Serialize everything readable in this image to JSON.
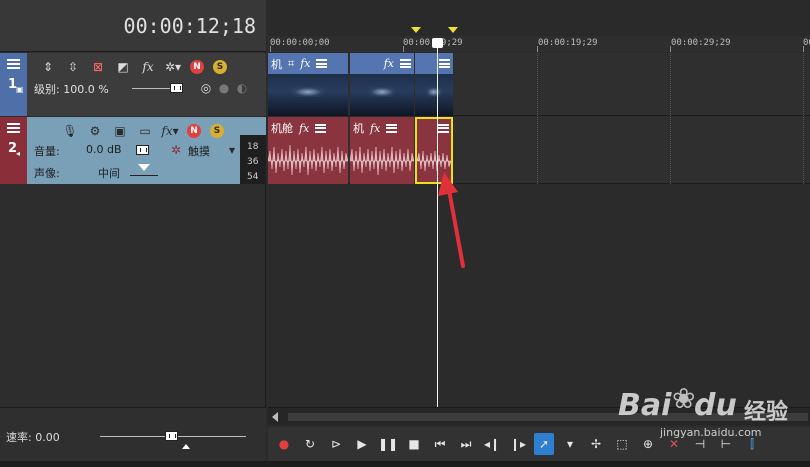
{
  "timecode": "00:00:12;18",
  "ruler": {
    "labels": [
      "00:00:00;00",
      "00:00:09;29",
      "00:00:19;29",
      "00:00:29;29"
    ],
    "partial_label": "00"
  },
  "track1": {
    "number": "1",
    "level_label": "级别: 100.0 %",
    "icons": [
      "move-up-icon",
      "move-down-icon",
      "bypass-icon",
      "compositing-icon",
      "fx-icon",
      "gear-icon",
      "mute-icon",
      "solo-icon"
    ]
  },
  "track2": {
    "number": "2",
    "volume_label": "音量:",
    "volume_value": "0.0 dB",
    "pan_label": "声像:",
    "pan_value": "中间",
    "mode_label": "触摸",
    "meter_ticks": [
      "18",
      "36",
      "54"
    ]
  },
  "video_clips": [
    {
      "title": "机"
    },
    {
      "title": ""
    },
    {
      "title": ""
    }
  ],
  "audio_clips": [
    {
      "title": "机舱"
    },
    {
      "title": "机"
    },
    {
      "title": ""
    }
  ],
  "rate": {
    "label": "速率: 0.00"
  },
  "transport": {
    "buttons": [
      "record",
      "loop",
      "play-from-start",
      "play",
      "pause",
      "stop",
      "go-to-start",
      "go-to-end",
      "prev-frame",
      "next-frame",
      "normal-edit-tool",
      "envelope-tool",
      "selection-tool",
      "zoom-tool",
      "delete-tool",
      "trim-start",
      "trim-end",
      "split"
    ]
  },
  "watermark": {
    "brand": "Bai",
    "brand2": "du",
    "cn": "经验",
    "url": "jingyan.baidu.com"
  },
  "colors": {
    "video_track": "#4f6fa8",
    "audio_track": "#8a2f3a",
    "selection": "#e8e020",
    "arrow": "#e0303a"
  }
}
